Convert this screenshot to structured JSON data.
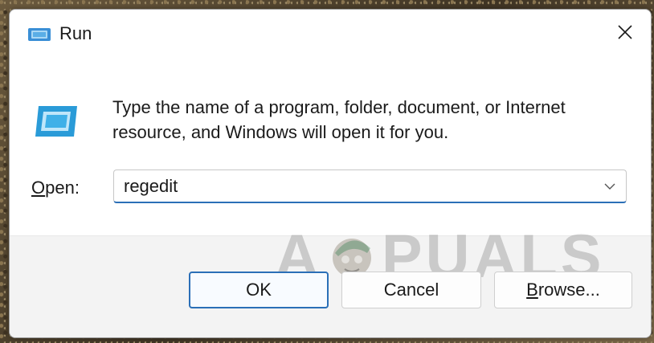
{
  "window": {
    "title": "Run",
    "title_icon": "run-icon",
    "close_icon": "close-icon"
  },
  "content": {
    "icon": "run-icon",
    "description": "Type the name of a program, folder, document, or Internet resource, and Windows will open it for you."
  },
  "open": {
    "label_underlined": "O",
    "label_rest": "pen:",
    "value": "regedit",
    "dropdown_icon": "chevron-down-icon"
  },
  "buttons": {
    "ok": "OK",
    "cancel": "Cancel",
    "browse_underlined": "B",
    "browse_rest": "rowse..."
  },
  "watermark": {
    "first": "A",
    "rest": "PUALS"
  },
  "colors": {
    "accent": "#2b6fb7",
    "icon_blue": "#2a9bd8",
    "footer_bg": "#f3f3f3"
  }
}
